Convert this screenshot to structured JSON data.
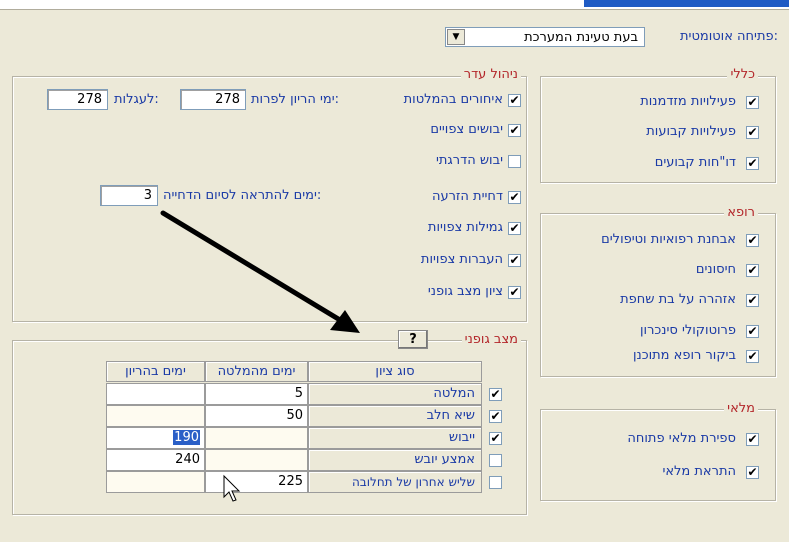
{
  "auto_open": {
    "label": "פתיחה אוטומטית:",
    "value": "בעת טעינת המערכת"
  },
  "general": {
    "title": "כללי",
    "items": [
      "פעילויות מזדמנות",
      "פעילויות קבועות",
      "דו\"חות קבועים"
    ]
  },
  "vet": {
    "title": "רופא",
    "items": [
      "אבחנת רפואיות וטיפולים",
      "חיסונים",
      "אזהרה על בת שחפת",
      "פרוטוקולי סינכרון",
      "ביקור רופא מתוכנן"
    ]
  },
  "inventory": {
    "title": "מלאי",
    "items": [
      "ספירת מלאי פתוחה",
      "התראת מלאי"
    ]
  },
  "herd": {
    "title": "ניהול עדר",
    "items": [
      "איחורים בהמלטות",
      "יבושים צפויים",
      "יבוש הדרגתי",
      "דחיית הזרעה",
      "גמילות צפויות",
      "העברות צפויות",
      "ציון מצב גופני"
    ],
    "pregnancy_days_label": "ימי הריון לפרות:",
    "pregnancy_days_cows": "278",
    "calves_label": "לעגלות:",
    "pregnancy_days_calves": "278",
    "postpone_label": "ימים להתראה לסיום הדחייה:",
    "postpone_days": "3"
  },
  "body_condition": {
    "title": "מצב גופני",
    "help": "?",
    "columns": [
      "סוג ציון",
      "ימים מהמלטה",
      "ימים בהריון"
    ],
    "rows": [
      {
        "name": "המלטה",
        "after_calving": "5",
        "pregnant": ""
      },
      {
        "name": "שיא חלב",
        "after_calving": "50",
        "pregnant": ""
      },
      {
        "name": "ייבוש",
        "after_calving": "",
        "pregnant": "190"
      },
      {
        "name": "אמצע יובש",
        "after_calving": "",
        "pregnant": "240"
      },
      {
        "name": "שליש אחרון של תחלובה",
        "after_calving": "225",
        "pregnant": ""
      }
    ]
  },
  "checks": {
    "general": [
      true,
      true,
      true
    ],
    "vet": [
      true,
      true,
      true,
      true,
      true
    ],
    "inventory": [
      true,
      true
    ],
    "herd": [
      true,
      true,
      false,
      true,
      true,
      true,
      true
    ],
    "body_condition": [
      true,
      true,
      true,
      false,
      false
    ]
  },
  "colors": {
    "label_blue": "#1a3aa6",
    "header_red": "#b3262a",
    "selection": "#2a5fc7"
  }
}
